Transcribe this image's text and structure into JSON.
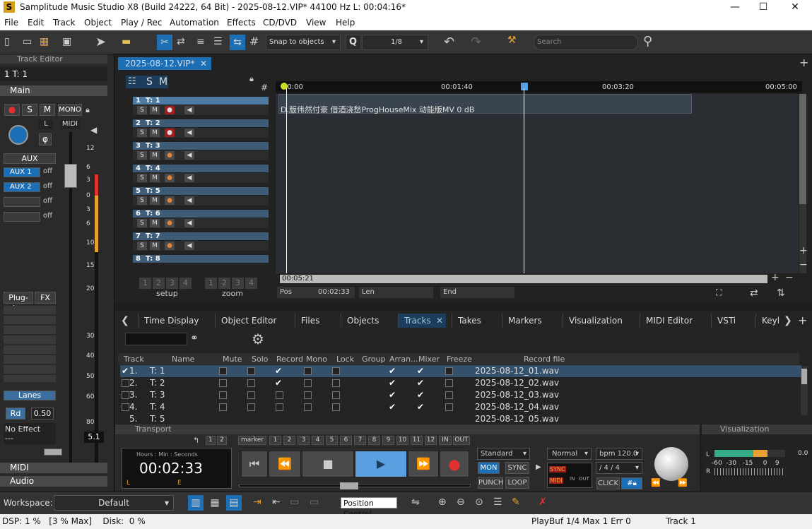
{
  "title": "Samplitude Music Studio X8 (Build 24222, 64 Bit)  -  2025-08-12.VIP*  44100 Hz L: 00:04:16*",
  "menu": [
    "File",
    "Edit",
    "Track",
    "Object",
    "Play / Rec",
    "Automation",
    "Effects",
    "CD/DVD",
    "View",
    "Help"
  ],
  "toolbar": {
    "snap": "Snap to objects",
    "q": "Q",
    "quant": "1/8",
    "search": "Search"
  },
  "left": {
    "panel_title": "Track Editor",
    "track_sel": "1  T: 1",
    "main": "Main",
    "mono": "MONO",
    "l": "L",
    "midi": "MIDI",
    "phase": "φ",
    "aux": "AUX",
    "aux1": "AUX  1",
    "aux2": "AUX  2",
    "off": "off",
    "plugins": "Plug-ins",
    "fx": "FX",
    "lanes": "Lanes",
    "rd": "Rd",
    "rd_val": "0.50",
    "noeffect": "No Effect",
    "dashes": "---",
    "fader_val": "5.1",
    "midi_sec": "MIDI",
    "audio_sec": "Audio",
    "scale": [
      "12",
      "6",
      "3",
      "0",
      "3",
      "6",
      "10",
      "15",
      "20",
      "30",
      "40",
      "50",
      "60",
      "80"
    ]
  },
  "editor": {
    "tab": "2025-08-12.VIP*",
    "time_labels": [
      "00:00",
      "00:01:40",
      "00:03:20",
      "00:05:00"
    ],
    "clip": "D.版伟然付豪 借酒浇愁ProgHouseMix 动能版MV    0 dB",
    "end_time": "00:05:21",
    "pos_label": "Pos",
    "pos_val": "00:02:33",
    "len_label": "Len",
    "end_label": "End",
    "setup": "setup",
    "zoom": "zoom",
    "nums": [
      "1",
      "2",
      "3",
      "4"
    ],
    "s": "S",
    "m": "M",
    "tracks": [
      {
        "n": "1",
        "name": "T: 1"
      },
      {
        "n": "2",
        "name": "T: 2"
      },
      {
        "n": "3",
        "name": "T: 3"
      },
      {
        "n": "4",
        "name": "T: 4"
      },
      {
        "n": "5",
        "name": "T: 5"
      },
      {
        "n": "6",
        "name": "T: 6"
      },
      {
        "n": "7",
        "name": "T: 7"
      },
      {
        "n": "8",
        "name": "T: 8"
      }
    ]
  },
  "tabs": [
    "Time Display",
    "Object Editor",
    "Files",
    "Objects",
    "Tracks",
    "Takes",
    "Markers",
    "Visualization",
    "MIDI Editor",
    "VSTi",
    "Keyl"
  ],
  "table": {
    "headers": [
      "Track",
      "Name",
      "Mute",
      "Solo",
      "Record",
      "Mono",
      "Lock",
      "Group",
      "Arran...",
      "Mixer",
      "Freeze",
      "Record file"
    ],
    "rows": [
      {
        "num": "1.",
        "name": "T: 1",
        "file": "2025-08-12_01.wav",
        "rec": true
      },
      {
        "num": "2.",
        "name": "T: 2",
        "file": "2025-08-12_02.wav",
        "rec": true
      },
      {
        "num": "3.",
        "name": "T: 3",
        "file": "2025-08-12_03.wav",
        "rec": false
      },
      {
        "num": "4.",
        "name": "T: 4",
        "file": "2025-08-12_04.wav",
        "rec": false
      },
      {
        "num": "5.",
        "name": "T: 5",
        "file": "2025-08-12_05.wav",
        "rec": false
      }
    ]
  },
  "transport": {
    "title": "Transport",
    "marker": "marker",
    "markers": [
      "1",
      "2",
      "3",
      "4",
      "5",
      "6",
      "7",
      "8",
      "9",
      "10",
      "11",
      "12"
    ],
    "in": "IN",
    "out": "OUT",
    "hms": "Hours : Min : Seconds",
    "time": "00:02:33",
    "l": "L",
    "e": "E",
    "standard": "Standard",
    "normal": "Normal",
    "bpm": "bpm 120.0",
    "sig": "/    4 / 4",
    "mon": "MON",
    "sync": "SYNC",
    "punch": "PUNCH",
    "loop": "LOOP",
    "click": "CLICK",
    "midi": "MIDI",
    "in_l": "IN",
    "out_l": "OUT",
    "sync2": "SYNC"
  },
  "viz": {
    "title": "Visualization",
    "l": "L",
    "r": "R",
    "scale": "-60  -30   -15     0    9",
    "val": "0.0"
  },
  "workspace": {
    "label": "Workspace:",
    "value": "Default",
    "tooltip": "Position Control"
  },
  "status": {
    "dsp": "DSP: 1 %   [3 % Max]    Disk:  0 %",
    "playbuf": "PlayBuf 1/4  Max 1  Err 0",
    "track": "Track 1"
  },
  "colors": {
    "accent": "#1d6fb5",
    "track": "#3e5b78",
    "clip": "#3a4450",
    "record": "#e03030",
    "play": "#5aa0e0"
  }
}
